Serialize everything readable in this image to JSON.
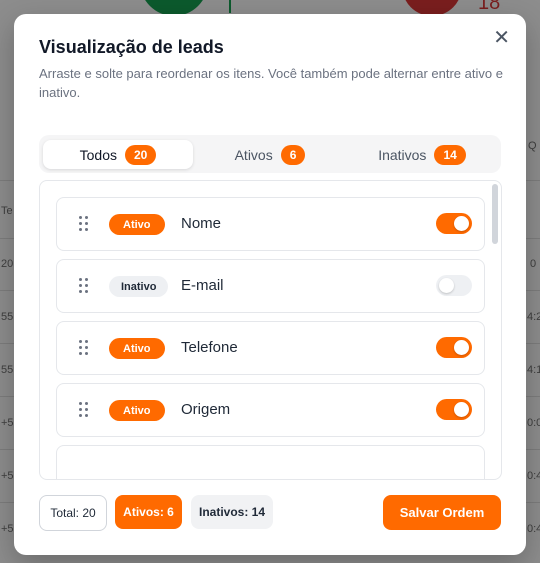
{
  "modal": {
    "title": "Visualização de leads",
    "subtitle": "Arraste e solte para reordenar os itens. Você também pode alternar entre ativo e inativo.",
    "close_icon": "close-icon"
  },
  "tabs": [
    {
      "label": "Todos",
      "count": "20",
      "active": true
    },
    {
      "label": "Ativos",
      "count": "6",
      "active": false
    },
    {
      "label": "Inativos",
      "count": "14",
      "active": false
    }
  ],
  "items": [
    {
      "status": "Ativo",
      "name": "Nome",
      "enabled": true
    },
    {
      "status": "Inativo",
      "name": "E-mail",
      "enabled": false
    },
    {
      "status": "Ativo",
      "name": "Telefone",
      "enabled": true
    },
    {
      "status": "Ativo",
      "name": "Origem",
      "enabled": true
    }
  ],
  "footer": {
    "total": "Total: 20",
    "active": "Ativos: 6",
    "inactive": "Inativos: 14",
    "save_label": "Salvar Ordem"
  },
  "colors": {
    "accent": "#ff6a00",
    "inactive_bg": "#eef0f3"
  },
  "background": {
    "red_number": "18",
    "left_labels": [
      "Te",
      "20",
      "55",
      "55",
      "+5",
      "+5",
      "+5"
    ],
    "right_labels": [
      "Q",
      "0",
      "4:2",
      "4:1",
      "0:0",
      "0:4",
      "0:4"
    ]
  }
}
